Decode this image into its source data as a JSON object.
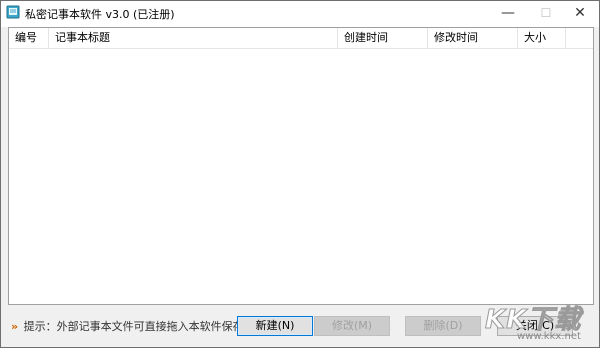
{
  "window": {
    "title": "私密记事本软件 v3.0 (已注册)",
    "minimize_glyph": "—",
    "maximize_glyph": "☐",
    "close_glyph": "✕"
  },
  "list": {
    "columns": [
      "编号",
      "记事本标题",
      "创建时间",
      "修改时间",
      "大小"
    ],
    "rows": []
  },
  "footer": {
    "hint_arrow": "»",
    "hint": "提示：外部记事本文件可直接拖入本软件保存",
    "buttons": {
      "new": "新建(N)",
      "edit": "修改(M)",
      "delete": "删除(D)",
      "close": "关闭(C)"
    }
  },
  "watermark": {
    "logo": "KK下载",
    "url": "www.kkx.net"
  },
  "colors": {
    "accent": "#0078d7",
    "disabled_text": "#a0a0a0",
    "hint_arrow": "#c86400"
  }
}
